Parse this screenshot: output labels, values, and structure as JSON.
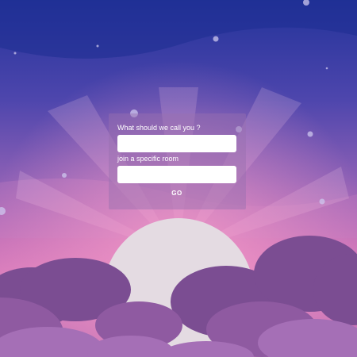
{
  "form": {
    "name_label": "What should we call you ?",
    "name_value": "",
    "room_label": "join a specific room",
    "room_value": "",
    "go_label": "GO"
  },
  "colors": {
    "sky_top": "#23339a",
    "sky_mid": "#8a5fb6",
    "horizon_glow": "#e07fbe",
    "sun": "#e5dde3",
    "cloud_front": "#7a4c91",
    "cloud_back": "#a66fb5",
    "card_overlay": "rgba(150,110,175,0.45)"
  }
}
